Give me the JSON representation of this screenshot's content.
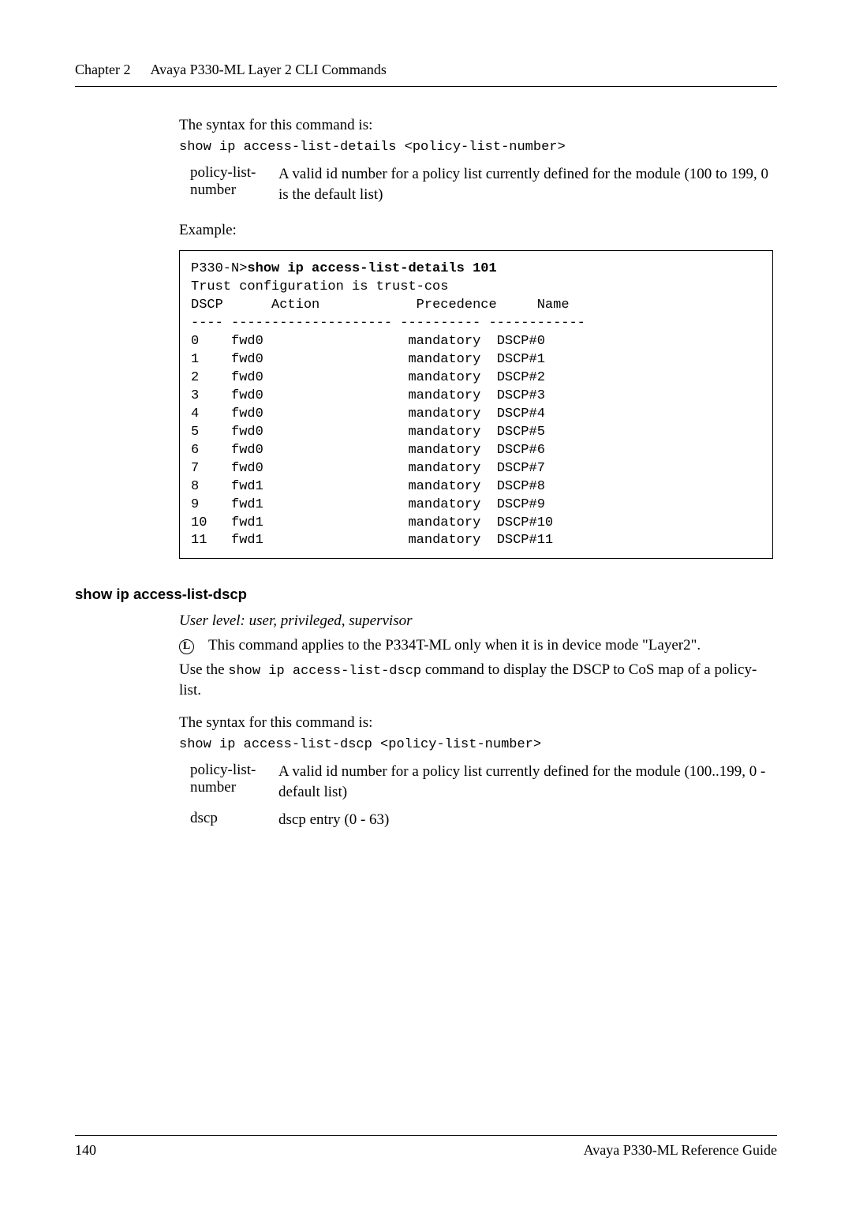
{
  "header": {
    "chapter_num": "Chapter 2",
    "chapter_title": "Avaya P330-ML Layer 2 CLI Commands"
  },
  "sec1": {
    "syntax_intro": "The syntax for this command is:",
    "syntax_cmd": "show ip access-list-details <policy-list-number>",
    "param_name": "policy-list-number",
    "param_desc": "A valid id number for a policy list currently defined for the module (100 to 199, 0 is the  default list)",
    "example_label": "Example:",
    "code_prefix": "P330-N>",
    "code_cmd": "show ip access-list-details 101",
    "code_line2": "Trust configuration is trust-cos",
    "code_h1": "DSCP",
    "code_h2": "Action",
    "code_h3": "Precedence",
    "code_h4": "Name",
    "code_dash": "---- -------------------- ---------- ------------",
    "rows": [
      {
        "a": "0",
        "b": "fwd0",
        "c": "mandatory",
        "d": "DSCP#0"
      },
      {
        "a": "1",
        "b": "fwd0",
        "c": "mandatory",
        "d": "DSCP#1"
      },
      {
        "a": "2",
        "b": "fwd0",
        "c": "mandatory",
        "d": "DSCP#2"
      },
      {
        "a": "3",
        "b": "fwd0",
        "c": "mandatory",
        "d": "DSCP#3"
      },
      {
        "a": "4",
        "b": "fwd0",
        "c": "mandatory",
        "d": "DSCP#4"
      },
      {
        "a": "5",
        "b": "fwd0",
        "c": "mandatory",
        "d": "DSCP#5"
      },
      {
        "a": "6",
        "b": "fwd0",
        "c": "mandatory",
        "d": "DSCP#6"
      },
      {
        "a": "7",
        "b": "fwd0",
        "c": "mandatory",
        "d": "DSCP#7"
      },
      {
        "a": "8",
        "b": "fwd1",
        "c": "mandatory",
        "d": "DSCP#8"
      },
      {
        "a": "9",
        "b": "fwd1",
        "c": "mandatory",
        "d": "DSCP#9"
      },
      {
        "a": "10",
        "b": "fwd1",
        "c": "mandatory",
        "d": "DSCP#10"
      },
      {
        "a": "11",
        "b": "fwd1",
        "c": "mandatory",
        "d": "DSCP#11"
      }
    ]
  },
  "sec2": {
    "heading": "show ip access-list-dscp",
    "user_level": "User level: user, privileged, supervisor",
    "note_icon": "L",
    "note_text": "This command applies to the P334T-ML only when it is in device mode \"Layer2\".",
    "use_pre": "Use the ",
    "use_mono": "show ip access-list-dscp",
    "use_post": " command to display the DSCP to CoS map of a policy-list.",
    "syntax_intro": "The syntax for this command is:",
    "syntax_cmd": "show ip access-list-dscp <policy-list-number>",
    "p1_name": "policy-list-number",
    "p1_desc": "A valid id number for a policy list currently defined for the module (100..199, 0 - default list)",
    "p2_name": "dscp",
    "p2_desc": "dscp entry (0 - 63)"
  },
  "footer": {
    "page": "140",
    "guide": "Avaya P330-ML Reference Guide"
  }
}
